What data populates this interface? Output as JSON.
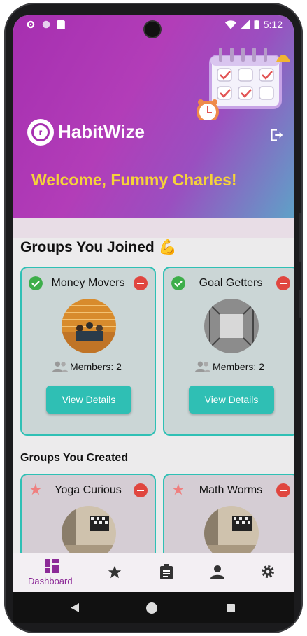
{
  "status_bar": {
    "time": "5:12"
  },
  "header": {
    "app_name": "HabitWize",
    "welcome": "Welcome, Fummy Charles!"
  },
  "joined": {
    "title": "Groups You Joined 💪",
    "groups": [
      {
        "name": "Money Movers",
        "members": "Members: 2",
        "button": "View Details"
      },
      {
        "name": "Goal Getters",
        "members": "Members: 2",
        "button": "View Details"
      }
    ]
  },
  "created": {
    "title": "Groups You Created",
    "groups": [
      {
        "name": "Yoga Curious"
      },
      {
        "name": "Math Worms"
      }
    ]
  },
  "nav": {
    "items": [
      {
        "icon": "dashboard-icon",
        "label": "Dashboard"
      },
      {
        "icon": "star-icon"
      },
      {
        "icon": "clipboard-icon"
      },
      {
        "icon": "person-icon"
      },
      {
        "icon": "gear-icon"
      }
    ]
  },
  "colors": {
    "accent": "#2fbfb4",
    "brand": "#a62fb0",
    "welcome": "#f5d23a",
    "danger": "#e0463f"
  }
}
